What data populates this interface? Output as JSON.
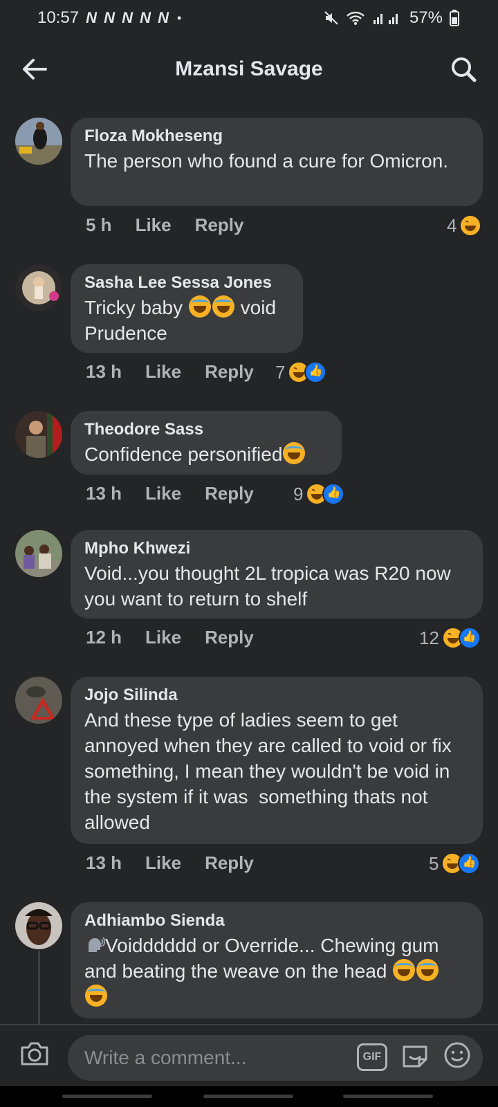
{
  "status_bar": {
    "time": "10:57",
    "notifications": "N N N N N",
    "dot": "•",
    "battery": "57%"
  },
  "header": {
    "title": "Mzansi Savage"
  },
  "comments": [
    {
      "author": "Floza Mokheseng",
      "text": "The person who found a cure for Omicron.",
      "time": "5 h",
      "like_label": "Like",
      "reply_label": "Reply",
      "reaction_count": "4",
      "reactions": [
        "haha"
      ]
    },
    {
      "author": "Sasha Lee Sessa Jones",
      "text_before": "Tricky baby",
      "text_after": "void Prudence",
      "time": "13 h",
      "like_label": "Like",
      "reply_label": "Reply",
      "reaction_count": "7",
      "reactions": [
        "haha",
        "like"
      ]
    },
    {
      "author": "Theodore Sass",
      "text": "Confidence personified",
      "time": "13 h",
      "like_label": "Like",
      "reply_label": "Reply",
      "reaction_count": "9",
      "reactions": [
        "haha",
        "like"
      ]
    },
    {
      "author": "Mpho Khwezi",
      "text": "Void...you thought 2L tropica was R20 now you want to return to shelf",
      "time": "12 h",
      "like_label": "Like",
      "reply_label": "Reply",
      "reaction_count": "12",
      "reactions": [
        "haha",
        "like"
      ]
    },
    {
      "author": "Jojo Silinda",
      "text": "And these type of ladies seem to get annoyed when they are called to void or fix something, I mean they wouldn't be void in the system if it was  something thats not allowed",
      "time": "13 h",
      "like_label": "Like",
      "reply_label": "Reply",
      "reaction_count": "5",
      "reactions": [
        "haha",
        "like"
      ]
    },
    {
      "author": "Adhiambo Sienda",
      "text_line1": "Voidddddd or Override... Chewing gum",
      "text_line2": "and beating the weave on the head"
    }
  ],
  "composer": {
    "placeholder": "Write a comment...",
    "gif_label": "GIF"
  },
  "colors": {
    "background": "#242526",
    "bubble": "#3a3b3c",
    "text": "#e4e6eb",
    "muted": "#b0b3b8",
    "like_blue": "#1877f2",
    "haha_yellow": "#f7b125"
  }
}
